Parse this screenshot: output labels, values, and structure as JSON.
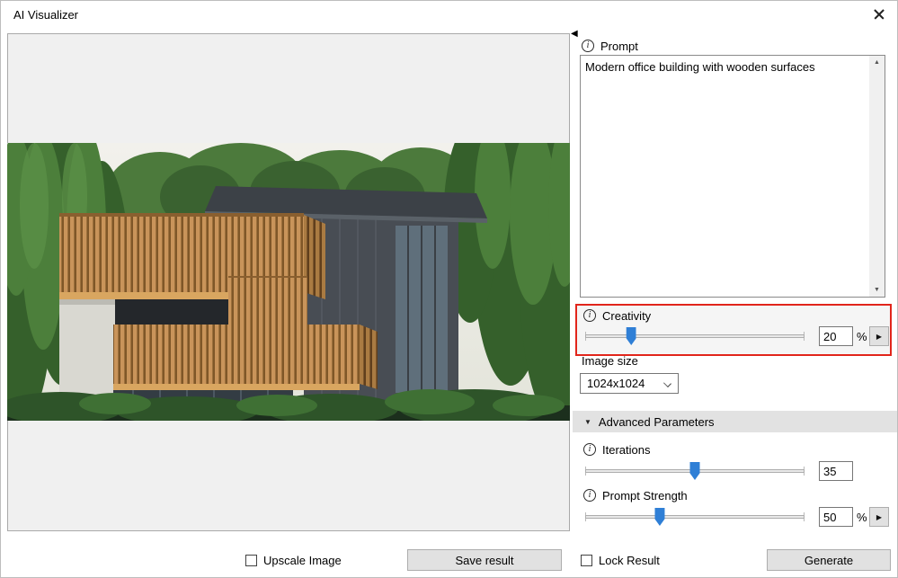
{
  "window": {
    "title": "AI Visualizer"
  },
  "icons": {
    "close": "close-x",
    "info": "i",
    "collapse_left": "◀",
    "scroll_up": "▲",
    "scroll_down": "▼",
    "advanced_expanded": "▼",
    "flyout_arrow": "▶"
  },
  "preview": {
    "image_alt": "Rendering of a modern office building with wooden slat facades surrounded by green forest",
    "upscale_label": "Upscale Image",
    "save_label": "Save result"
  },
  "prompt": {
    "label": "Prompt",
    "value": "Modern office building with wooden surfaces"
  },
  "creativity": {
    "label": "Creativity",
    "value": "20",
    "unit": "%",
    "thumb_percent": 21
  },
  "image_size": {
    "label": "Image size",
    "value": "1024x1024"
  },
  "advanced": {
    "label": "Advanced Parameters"
  },
  "iterations": {
    "label": "Iterations",
    "value": "35",
    "thumb_percent": 50
  },
  "prompt_strength": {
    "label": "Prompt Strength",
    "value": "50",
    "unit": "%",
    "thumb_percent": 34
  },
  "footer": {
    "lock_label": "Lock Result",
    "generate_label": "Generate"
  },
  "colors": {
    "accent_blue": "#2f7fd6",
    "highlight_red": "#e1251b"
  }
}
